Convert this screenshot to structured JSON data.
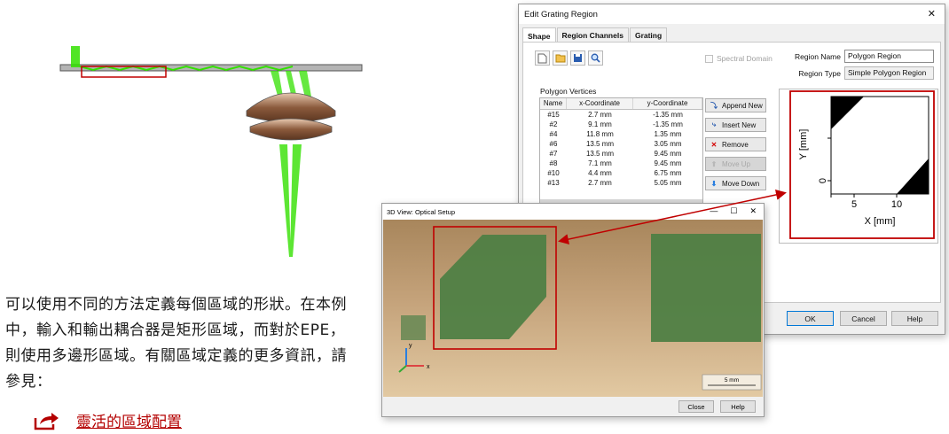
{
  "description": "可以使用不同的方法定義每個區域的形狀。在本例中，輸入和輸出耦合器是矩形區域，而對於EPE，則使用多邊形區域。有關區域定義的更多資訊，請參見：",
  "link": {
    "text": "靈活的區域配置"
  },
  "dialog": {
    "title": "Edit Grating Region",
    "close_glyph": "✕",
    "tabs": [
      "Shape",
      "Region Channels",
      "Grating"
    ],
    "spectral_domain_label": "Spectral Domain",
    "region_name_label": "Region Name",
    "region_name_value": "Polygon Region",
    "region_type_label": "Region Type",
    "region_type_value": "Simple Polygon Region",
    "polygon_vertices_label": "Polygon Vertices",
    "table": {
      "columns": [
        "Name",
        "x-Coordinate",
        "y-Coordinate"
      ],
      "rows": [
        [
          "#15",
          "2.7 mm",
          "-1.35 mm"
        ],
        [
          "#2",
          "9.1 mm",
          "-1.35 mm"
        ],
        [
          "#4",
          "11.8 mm",
          "1.35 mm"
        ],
        [
          "#6",
          "13.5 mm",
          "3.05 mm"
        ],
        [
          "#7",
          "13.5 mm",
          "9.45 mm"
        ],
        [
          "#8",
          "7.1 mm",
          "9.45 mm"
        ],
        [
          "#10",
          "4.4 mm",
          "6.75 mm"
        ],
        [
          "#13",
          "2.7 mm",
          "5.05 mm"
        ]
      ]
    },
    "buttons": {
      "append": "Append New",
      "insert": "Insert New",
      "remove": "Remove",
      "move_up": "Move Up",
      "move_down": "Move Down",
      "ok": "OK",
      "cancel": "Cancel",
      "help": "Help"
    },
    "plot": {
      "y_label": "Y [mm]",
      "x_label": "X [mm]",
      "x_ticks": [
        "5",
        "10"
      ],
      "y_ticks": [
        "0",
        "5"
      ]
    }
  },
  "view3d": {
    "title": "3D View: Optical Setup",
    "controls": [
      "—",
      "☐",
      "✕"
    ],
    "scale_label": "5 mm",
    "axis_y": "y",
    "axis_x": "x",
    "close": "Close",
    "help": "Help"
  },
  "colors": {
    "highlight": "#c00000",
    "grating_green": "#4f7f44",
    "beam_green": "#33e000",
    "lens_brown": "#8b5a3c"
  }
}
